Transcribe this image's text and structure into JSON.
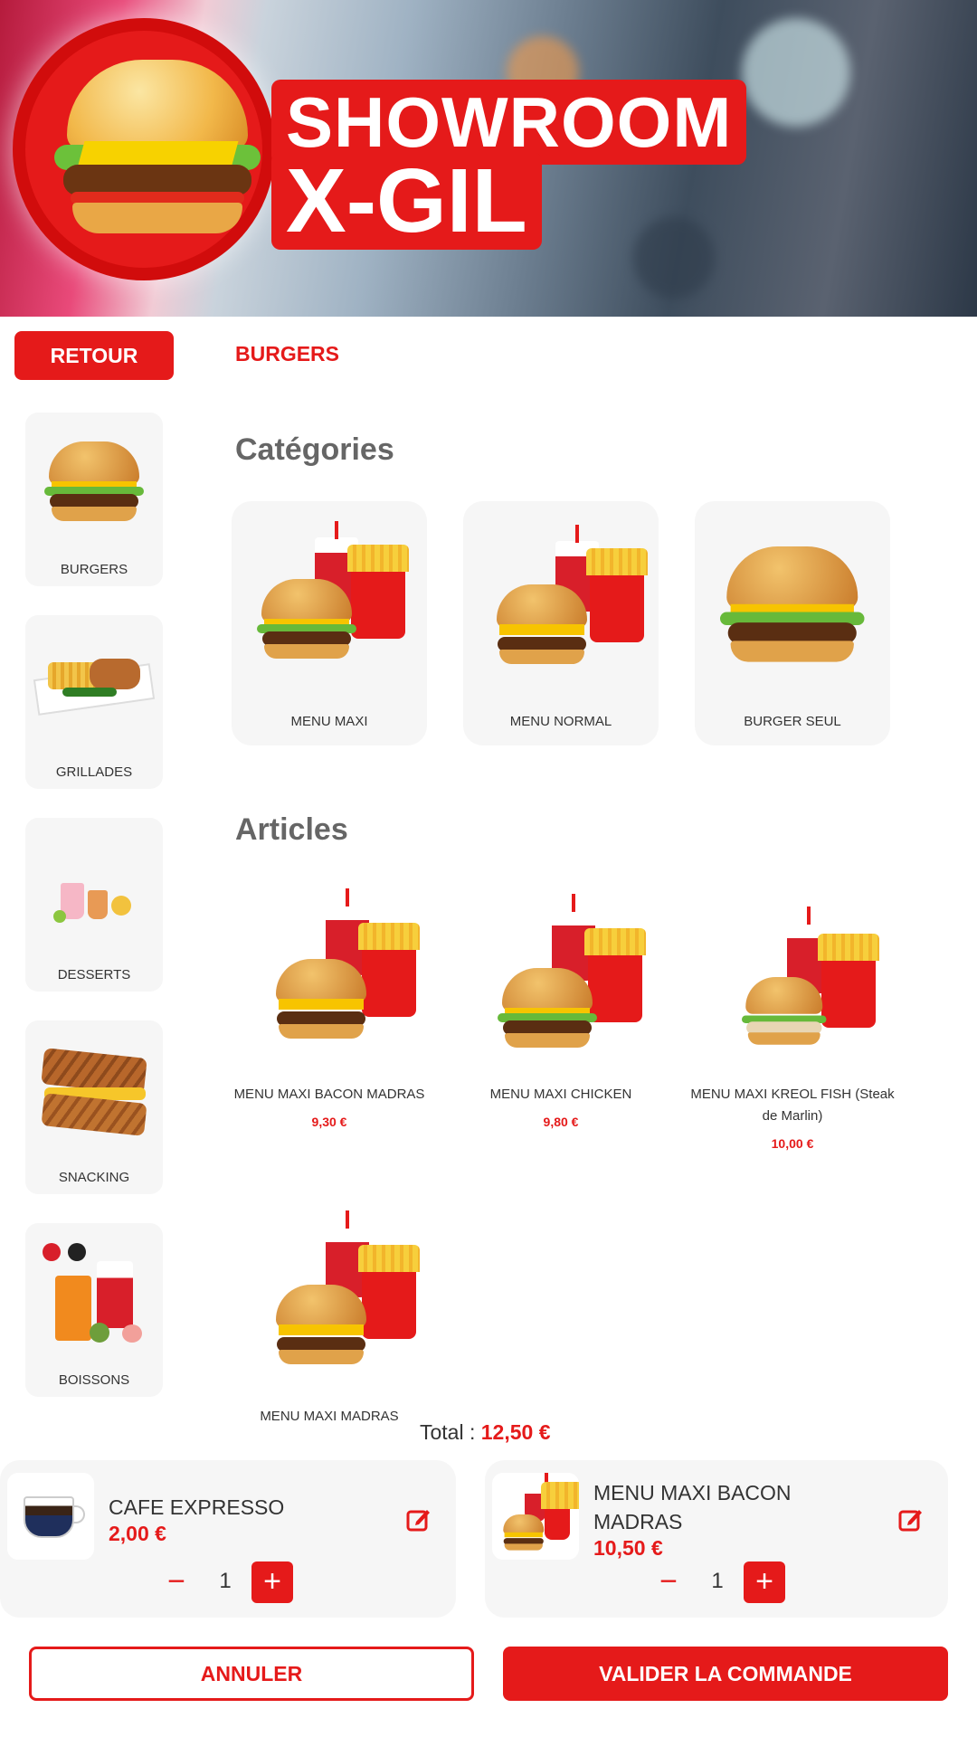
{
  "banner": {
    "brand_line1": "SHOWROOM",
    "brand_line2": "X-GIL"
  },
  "topbar": {
    "back_label": "RETOUR",
    "current_category": "BURGERS"
  },
  "sidebar": {
    "items": [
      {
        "label": "BURGERS",
        "icon": "burger-image"
      },
      {
        "label": "GRILLADES",
        "icon": "grill-plate-image"
      },
      {
        "label": "DESSERTS",
        "icon": "dessert-drinks-image"
      },
      {
        "label": "SNACKING",
        "icon": "sandwich-image"
      },
      {
        "label": "BOISSONS",
        "icon": "drinks-image"
      }
    ]
  },
  "categories": {
    "heading": "Catégories",
    "items": [
      {
        "label": "MENU MAXI"
      },
      {
        "label": "MENU NORMAL"
      },
      {
        "label": "BURGER SEUL"
      }
    ]
  },
  "articles": {
    "heading": "Articles",
    "items": [
      {
        "name": "MENU MAXI BACON MADRAS",
        "price": "9,30 €"
      },
      {
        "name": "MENU MAXI CHICKEN",
        "price": "9,80 €"
      },
      {
        "name": "MENU MAXI KREOL FISH (Steak de Marlin)",
        "price": "10,00 €"
      },
      {
        "name": "MENU MAXI MADRAS",
        "price": ""
      }
    ]
  },
  "total": {
    "label": "Total :",
    "value": "12,50 €"
  },
  "cart": {
    "items": [
      {
        "name": "CAFE EXPRESSO",
        "price": "2,00 €",
        "quantity": "1",
        "minus": "−",
        "plus": "+"
      },
      {
        "name": "MENU MAXI BACON MADRAS",
        "price": "10,50 €",
        "quantity": "1",
        "minus": "−",
        "plus": "+"
      }
    ]
  },
  "actions": {
    "cancel_label": "ANNULER",
    "confirm_label": "VALIDER LA COMMANDE"
  },
  "colors": {
    "accent": "#e51a1a",
    "card_bg": "#f6f6f6",
    "heading_gray": "#666666"
  }
}
